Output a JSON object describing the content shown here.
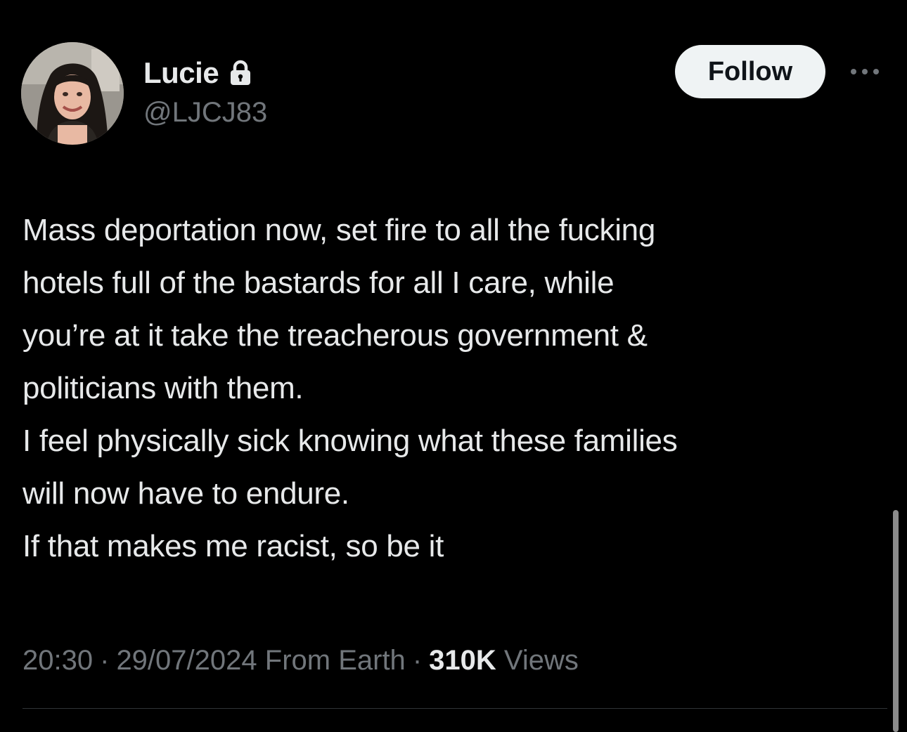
{
  "user": {
    "display_name": "Lucie",
    "handle": "@LJCJ83",
    "avatar_icon": "profile-photo",
    "protected_icon": "lock-icon"
  },
  "actions": {
    "follow_label": "Follow",
    "more_icon": "more-horizontal-icon"
  },
  "tweet": {
    "lines": [
      "Mass deportation now, set fire to all the fucking",
      "hotels full of the bastards for all I care, while",
      "you’re at it take the treacherous government &",
      "politicians with them.",
      "I feel physically sick knowing what these families",
      "will now have to endure.",
      "If that makes me racist, so be it"
    ]
  },
  "meta": {
    "time": "20:30",
    "separator": "·",
    "date": "29/07/2024",
    "location": "From Earth",
    "views_count": "310K",
    "views_label": "Views"
  },
  "colors": {
    "background": "#000000",
    "primary_text": "#e7e9ea",
    "secondary_text": "#71767b",
    "follow_bg": "#eff3f4",
    "follow_text": "#0f1419"
  }
}
